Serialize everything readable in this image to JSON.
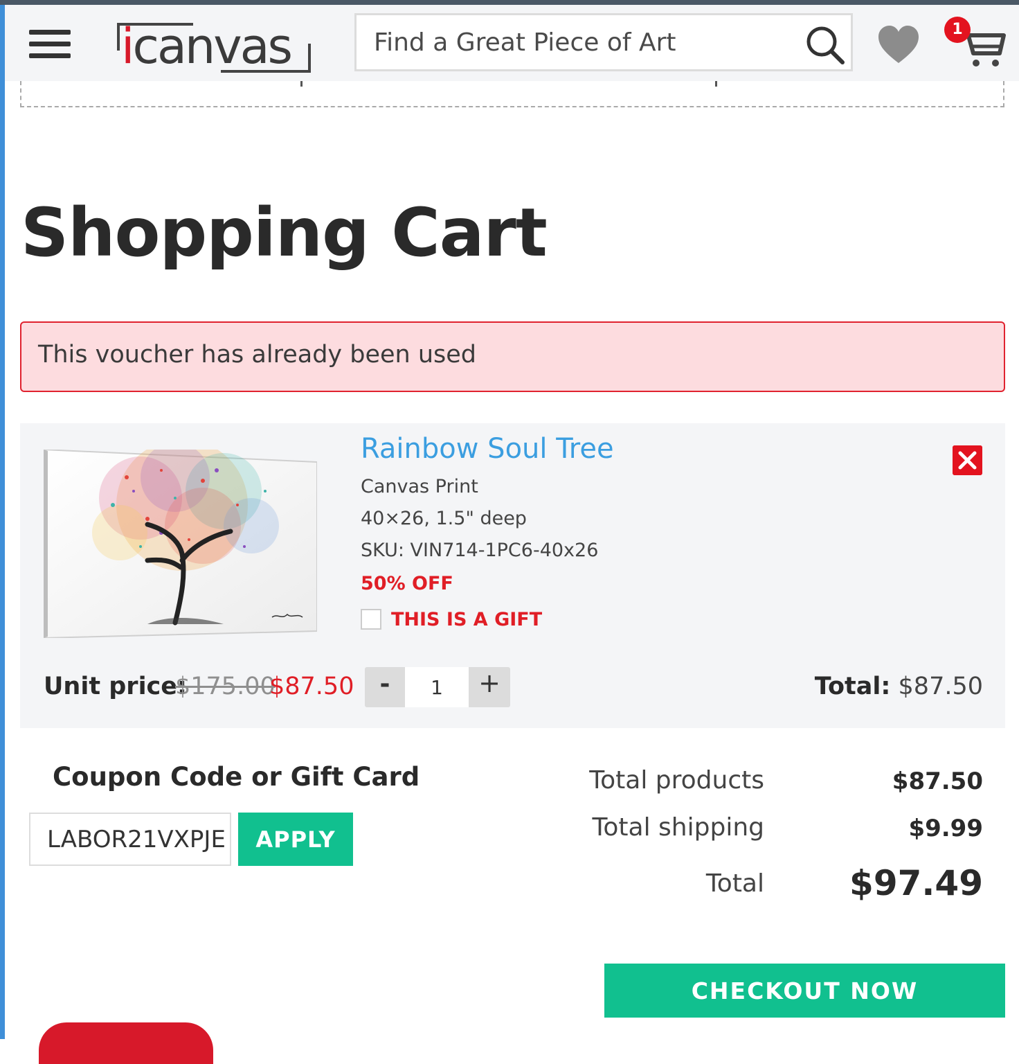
{
  "header": {
    "menu_icon": "hamburger-menu-icon",
    "logo_text": "icanvas",
    "search": {
      "placeholder": "Find a Great Piece of Art",
      "value": ""
    },
    "wishlist_icon": "heart-icon",
    "cart_icon": "cart-icon",
    "cart_count": "1"
  },
  "page": {
    "title": "Shopping Cart"
  },
  "alert": {
    "message": "This voucher has already been used"
  },
  "cart_item": {
    "name": "Rainbow Soul Tree",
    "type": "Canvas Print",
    "size": "40×26, 1.5\" deep",
    "sku": "SKU: VIN714-1PC6-40x26",
    "discount": "50% OFF",
    "gift_label": "THIS IS A GIFT",
    "gift_checked": false,
    "unit_price_label": "Unit price:",
    "old_price": "$175.00",
    "new_price": "$87.50",
    "quantity": "1",
    "qty_minus": "-",
    "qty_plus": "+",
    "total_label": "Total:",
    "total_value": "$87.50"
  },
  "coupon": {
    "title": "Coupon Code or Gift Card",
    "value": "LABOR21VXPJE",
    "apply_label": "APPLY"
  },
  "summary": {
    "products_label": "Total products",
    "products_value": "$87.50",
    "shipping_label": "Total shipping",
    "shipping_value": "$9.99",
    "total_label": "Total",
    "total_value": "$97.49"
  },
  "checkout": {
    "label": "CHECKOUT NOW"
  },
  "colors": {
    "brand_red": "#d7192a",
    "accent_green": "#11c08f",
    "link_blue": "#3b9ee0",
    "alert_bg": "#fddcdf"
  }
}
